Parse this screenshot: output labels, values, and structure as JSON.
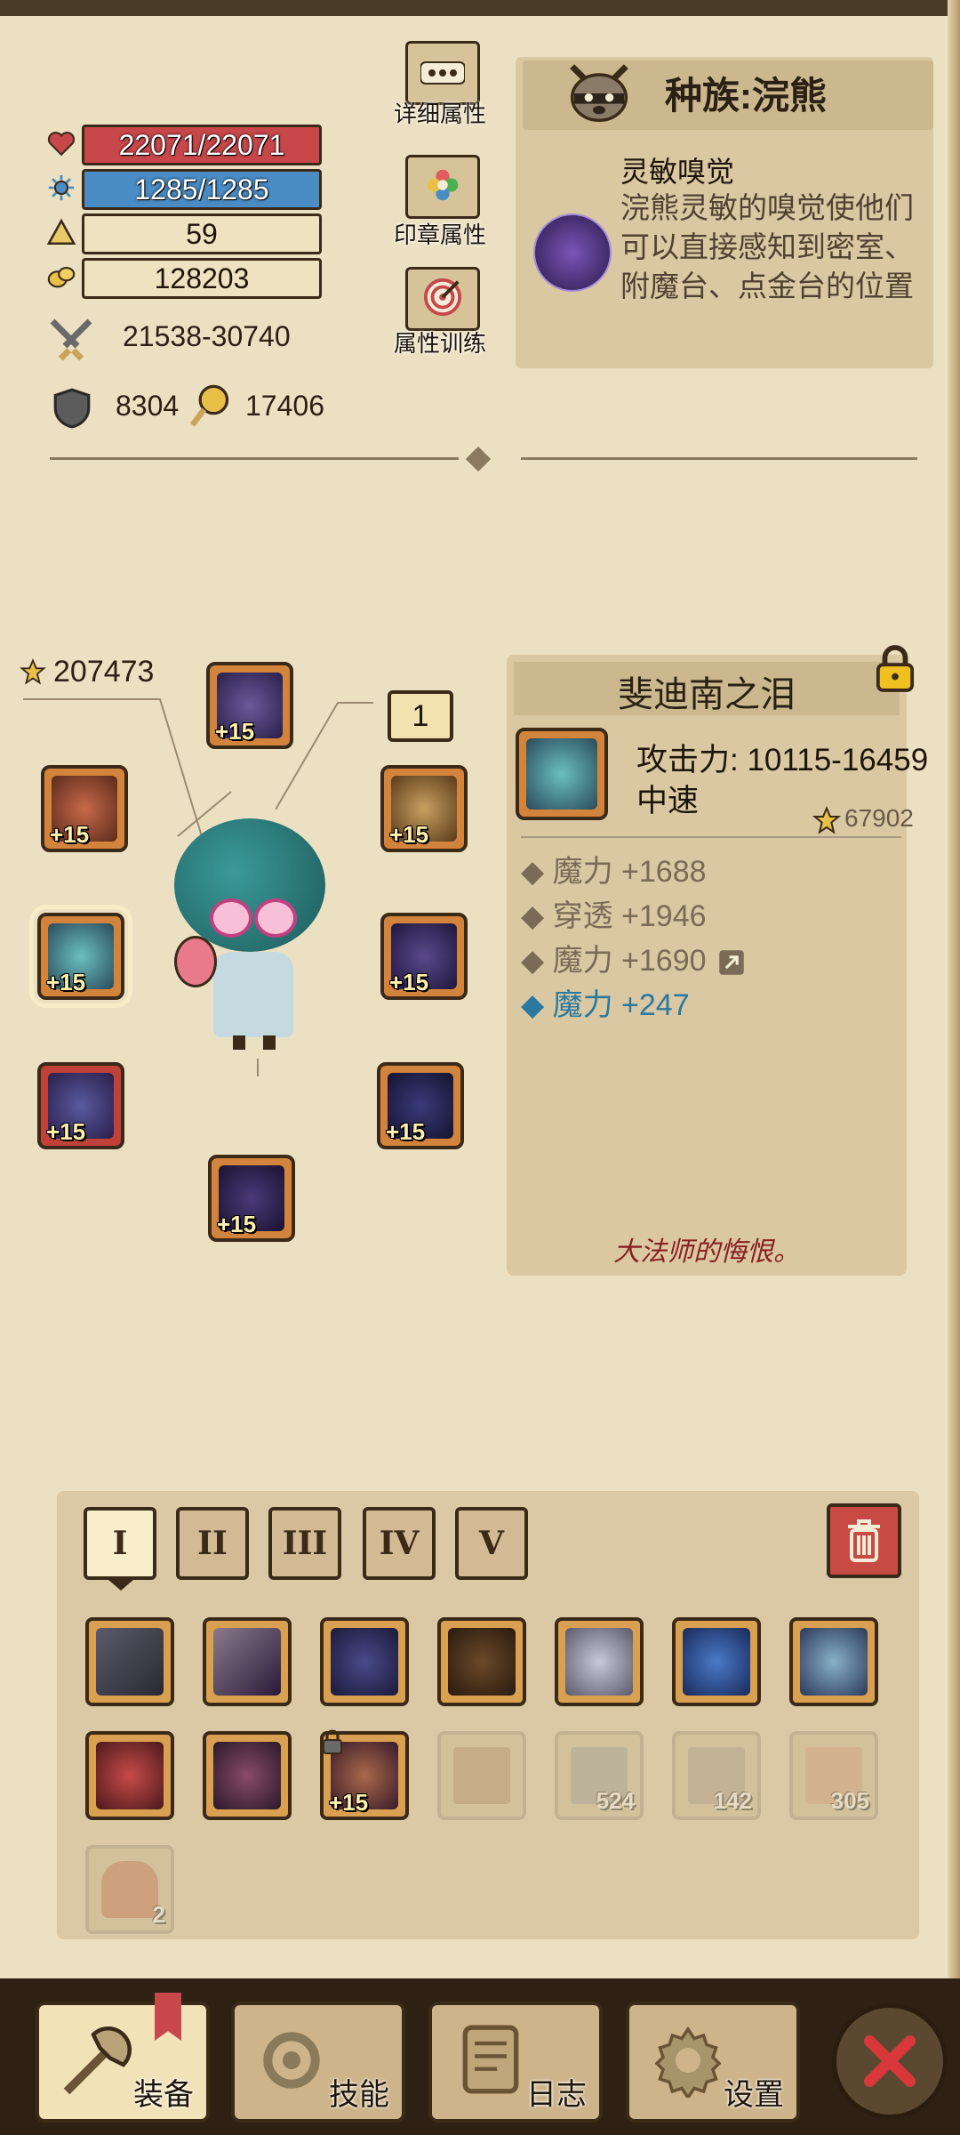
{
  "stats": {
    "hp": "22071/22071",
    "mp": "1285/1285",
    "level": "59",
    "gold": "128203",
    "attack": "21538-30740",
    "armor": "8304",
    "magic_resist": "17406"
  },
  "side_buttons": {
    "detail": "详细属性",
    "seal": "印章属性",
    "training": "属性训练"
  },
  "race": {
    "title": "种族:浣熊",
    "skill_name": "灵敏嗅觉",
    "skill_desc": "浣熊灵敏的嗅觉使他们可以直接感知到密室、附魔台、点金台的位置"
  },
  "equipment": {
    "score": "207473",
    "ring_count": "1",
    "plus": "+15"
  },
  "item": {
    "name": "斐迪南之泪",
    "attack": "攻击力: 10115-16459",
    "speed": "中速",
    "score": "67902",
    "attrs": [
      {
        "text": "魔力 +1688"
      },
      {
        "text": "穿透 +1946"
      },
      {
        "text": "魔力 +1690"
      },
      {
        "text": "魔力 +247"
      }
    ],
    "flavor": "大法师的悔恨。"
  },
  "inventory": {
    "tabs": [
      "I",
      "II",
      "III",
      "IV",
      "V"
    ],
    "counts": [
      "524",
      "142",
      "305",
      "2"
    ],
    "plus": "+15"
  },
  "nav": {
    "equip": "装备",
    "skills": "技能",
    "log": "日志",
    "settings": "设置"
  },
  "colors": {
    "paper": "#ece0c2",
    "hp": "#c8474a",
    "mp": "#4a8cc4",
    "slot": "#d3843c",
    "accent_blue": "#2a7aa0"
  }
}
